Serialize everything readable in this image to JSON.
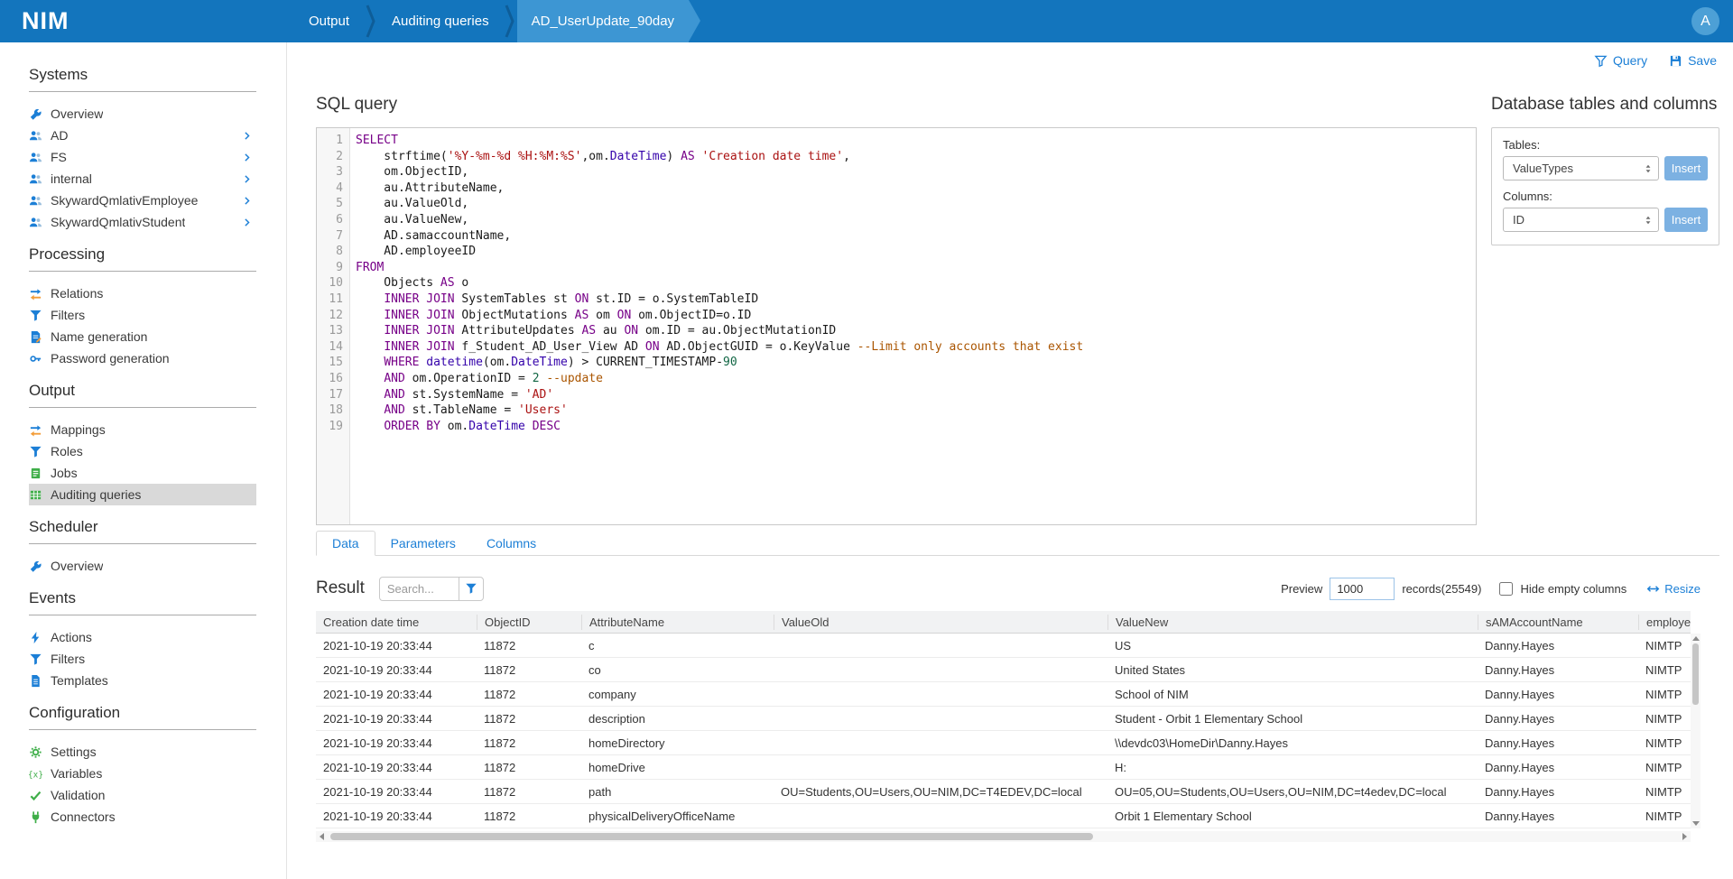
{
  "app": {
    "logo": "NIM"
  },
  "header": {
    "breadcrumbs": [
      {
        "label": "Output",
        "active": false
      },
      {
        "label": "Auditing queries",
        "active": false
      },
      {
        "label": "AD_UserUpdate_90day",
        "active": true
      }
    ],
    "avatar": "A"
  },
  "sidebar": {
    "sections": [
      {
        "title": "Systems",
        "items": [
          {
            "label": "Overview",
            "icon": "wrench-icon"
          },
          {
            "label": "AD",
            "icon": "users-icon",
            "expandable": true
          },
          {
            "label": "FS",
            "icon": "users-icon",
            "expandable": true
          },
          {
            "label": "internal",
            "icon": "users-icon",
            "expandable": true
          },
          {
            "label": "SkywardQmlativEmployee",
            "icon": "users-icon",
            "expandable": true
          },
          {
            "label": "SkywardQmlativStudent",
            "icon": "users-icon",
            "expandable": true
          }
        ]
      },
      {
        "title": "Processing",
        "items": [
          {
            "label": "Relations",
            "icon": "swap-arrows-icon"
          },
          {
            "label": "Filters",
            "icon": "funnel-icon"
          },
          {
            "label": "Name generation",
            "icon": "name-generation-icon"
          },
          {
            "label": "Password generation",
            "icon": "key-icon"
          }
        ]
      },
      {
        "title": "Output",
        "items": [
          {
            "label": "Mappings",
            "icon": "swap-arrows-icon"
          },
          {
            "label": "Roles",
            "icon": "funnel-icon"
          },
          {
            "label": "Jobs",
            "icon": "jobs-icon"
          },
          {
            "label": "Auditing queries",
            "icon": "table-icon",
            "selected": true
          }
        ]
      },
      {
        "title": "Scheduler",
        "items": [
          {
            "label": "Overview",
            "icon": "wrench-icon"
          }
        ]
      },
      {
        "title": "Events",
        "items": [
          {
            "label": "Actions",
            "icon": "bolt-icon"
          },
          {
            "label": "Filters",
            "icon": "funnel-icon"
          },
          {
            "label": "Templates",
            "icon": "doc-icon"
          }
        ]
      },
      {
        "title": "Configuration",
        "items": [
          {
            "label": "Settings",
            "icon": "gear-icon"
          },
          {
            "label": "Variables",
            "icon": "variables-icon"
          },
          {
            "label": "Validation",
            "icon": "check-icon"
          },
          {
            "label": "Connectors",
            "icon": "plug-icon"
          }
        ]
      }
    ]
  },
  "toolbar": {
    "query_label": "Query",
    "save_label": "Save"
  },
  "editor": {
    "title": "SQL query",
    "lines": [
      [
        {
          "t": "kw",
          "v": "SELECT"
        }
      ],
      [
        {
          "t": "pl",
          "v": "    strftime("
        },
        {
          "t": "str",
          "v": "'%Y-%m-%d %H:%M:%S'"
        },
        {
          "t": "pl",
          "v": ",om."
        },
        {
          "t": "type",
          "v": "DateTime"
        },
        {
          "t": "pl",
          "v": ") "
        },
        {
          "t": "kw",
          "v": "AS"
        },
        {
          "t": "pl",
          "v": " "
        },
        {
          "t": "str",
          "v": "'Creation date time'"
        },
        {
          "t": "pl",
          "v": ","
        }
      ],
      [
        {
          "t": "pl",
          "v": "    om.ObjectID,"
        }
      ],
      [
        {
          "t": "pl",
          "v": "    au.AttributeName,"
        }
      ],
      [
        {
          "t": "pl",
          "v": "    au.ValueOld,"
        }
      ],
      [
        {
          "t": "pl",
          "v": "    au.ValueNew,"
        }
      ],
      [
        {
          "t": "pl",
          "v": "    AD.samaccountName,"
        }
      ],
      [
        {
          "t": "pl",
          "v": "    AD.employeeID"
        }
      ],
      [
        {
          "t": "kw",
          "v": "FROM"
        }
      ],
      [
        {
          "t": "pl",
          "v": "    Objects "
        },
        {
          "t": "kw",
          "v": "AS"
        },
        {
          "t": "pl",
          "v": " o"
        }
      ],
      [
        {
          "t": "pl",
          "v": "    "
        },
        {
          "t": "kw",
          "v": "INNER JOIN"
        },
        {
          "t": "pl",
          "v": " SystemTables st "
        },
        {
          "t": "kw",
          "v": "ON"
        },
        {
          "t": "pl",
          "v": " st.ID = o.SystemTableID"
        }
      ],
      [
        {
          "t": "pl",
          "v": "    "
        },
        {
          "t": "kw",
          "v": "INNER JOIN"
        },
        {
          "t": "pl",
          "v": " ObjectMutations "
        },
        {
          "t": "kw",
          "v": "AS"
        },
        {
          "t": "pl",
          "v": " om "
        },
        {
          "t": "kw",
          "v": "ON"
        },
        {
          "t": "pl",
          "v": " om.ObjectID=o.ID"
        }
      ],
      [
        {
          "t": "pl",
          "v": "    "
        },
        {
          "t": "kw",
          "v": "INNER JOIN"
        },
        {
          "t": "pl",
          "v": " AttributeUpdates "
        },
        {
          "t": "kw",
          "v": "AS"
        },
        {
          "t": "pl",
          "v": " au "
        },
        {
          "t": "kw",
          "v": "ON"
        },
        {
          "t": "pl",
          "v": " om.ID = au.ObjectMutationID"
        }
      ],
      [
        {
          "t": "pl",
          "v": "    "
        },
        {
          "t": "kw",
          "v": "INNER JOIN"
        },
        {
          "t": "pl",
          "v": " f_Student_AD_User_View AD "
        },
        {
          "t": "kw",
          "v": "ON"
        },
        {
          "t": "pl",
          "v": " AD.ObjectGUID = o.KeyValue "
        },
        {
          "t": "cmt",
          "v": "--Limit only accounts that exist"
        }
      ],
      [
        {
          "t": "pl",
          "v": "    "
        },
        {
          "t": "kw",
          "v": "WHERE"
        },
        {
          "t": "pl",
          "v": " "
        },
        {
          "t": "type",
          "v": "datetime"
        },
        {
          "t": "pl",
          "v": "(om."
        },
        {
          "t": "type",
          "v": "DateTime"
        },
        {
          "t": "pl",
          "v": ") > CURRENT_TIMESTAMP-"
        },
        {
          "t": "num",
          "v": "90"
        }
      ],
      [
        {
          "t": "pl",
          "v": "    "
        },
        {
          "t": "kw",
          "v": "AND"
        },
        {
          "t": "pl",
          "v": " om.OperationID = "
        },
        {
          "t": "num",
          "v": "2"
        },
        {
          "t": "pl",
          "v": " "
        },
        {
          "t": "cmt",
          "v": "--update"
        }
      ],
      [
        {
          "t": "pl",
          "v": "    "
        },
        {
          "t": "kw",
          "v": "AND"
        },
        {
          "t": "pl",
          "v": " st.SystemName = "
        },
        {
          "t": "str",
          "v": "'AD'"
        }
      ],
      [
        {
          "t": "pl",
          "v": "    "
        },
        {
          "t": "kw",
          "v": "AND"
        },
        {
          "t": "pl",
          "v": " st.TableName = "
        },
        {
          "t": "str",
          "v": "'Users'"
        }
      ],
      [
        {
          "t": "pl",
          "v": "    "
        },
        {
          "t": "kw",
          "v": "ORDER BY"
        },
        {
          "t": "pl",
          "v": " om."
        },
        {
          "t": "type",
          "v": "DateTime"
        },
        {
          "t": "pl",
          "v": " "
        },
        {
          "t": "kw",
          "v": "DESC"
        }
      ]
    ]
  },
  "db_panel": {
    "title": "Database tables and columns",
    "tables_label": "Tables:",
    "tables_value": "ValueTypes",
    "columns_label": "Columns:",
    "columns_value": "ID",
    "insert_label": "Insert"
  },
  "tabs": [
    {
      "label": "Data",
      "active": true
    },
    {
      "label": "Parameters",
      "active": false
    },
    {
      "label": "Columns",
      "active": false
    }
  ],
  "result": {
    "title": "Result",
    "search_placeholder": "Search...",
    "preview_label": "Preview",
    "preview_value": "1000",
    "records_text": "records(25549)",
    "hide_empty_label": "Hide empty columns",
    "resize_label": "Resize",
    "table": {
      "columns": [
        "Creation date time",
        "ObjectID",
        "AttributeName",
        "ValueOld",
        "ValueNew",
        "sAMAccountName",
        "employee"
      ],
      "rows": [
        [
          "2021-10-19 20:33:44",
          "11872",
          "c",
          "",
          "US",
          "Danny.Hayes",
          "NIMTP"
        ],
        [
          "2021-10-19 20:33:44",
          "11872",
          "co",
          "",
          "United States",
          "Danny.Hayes",
          "NIMTP"
        ],
        [
          "2021-10-19 20:33:44",
          "11872",
          "company",
          "",
          "School of NIM",
          "Danny.Hayes",
          "NIMTP"
        ],
        [
          "2021-10-19 20:33:44",
          "11872",
          "description",
          "",
          "Student - Orbit 1 Elementary School",
          "Danny.Hayes",
          "NIMTP"
        ],
        [
          "2021-10-19 20:33:44",
          "11872",
          "homeDirectory",
          "",
          "\\\\devdc03\\HomeDir\\Danny.Hayes",
          "Danny.Hayes",
          "NIMTP"
        ],
        [
          "2021-10-19 20:33:44",
          "11872",
          "homeDrive",
          "",
          "H:",
          "Danny.Hayes",
          "NIMTP"
        ],
        [
          "2021-10-19 20:33:44",
          "11872",
          "path",
          "OU=Students,OU=Users,OU=NIM,DC=T4EDEV,DC=local",
          "OU=05,OU=Students,OU=Users,OU=NIM,DC=t4edev,DC=local",
          "Danny.Hayes",
          "NIMTP"
        ],
        [
          "2021-10-19 20:33:44",
          "11872",
          "physicalDeliveryOfficeName",
          "",
          "Orbit 1 Elementary School",
          "Danny.Hayes",
          "NIMTP"
        ]
      ]
    }
  },
  "colors": {
    "topbar": "#1375bd",
    "active_crumb": "#3d96d3",
    "link_blue": "#1c7fd6",
    "icon_green": "#3fae49",
    "selected_item_bg": "#d9d9d9"
  }
}
